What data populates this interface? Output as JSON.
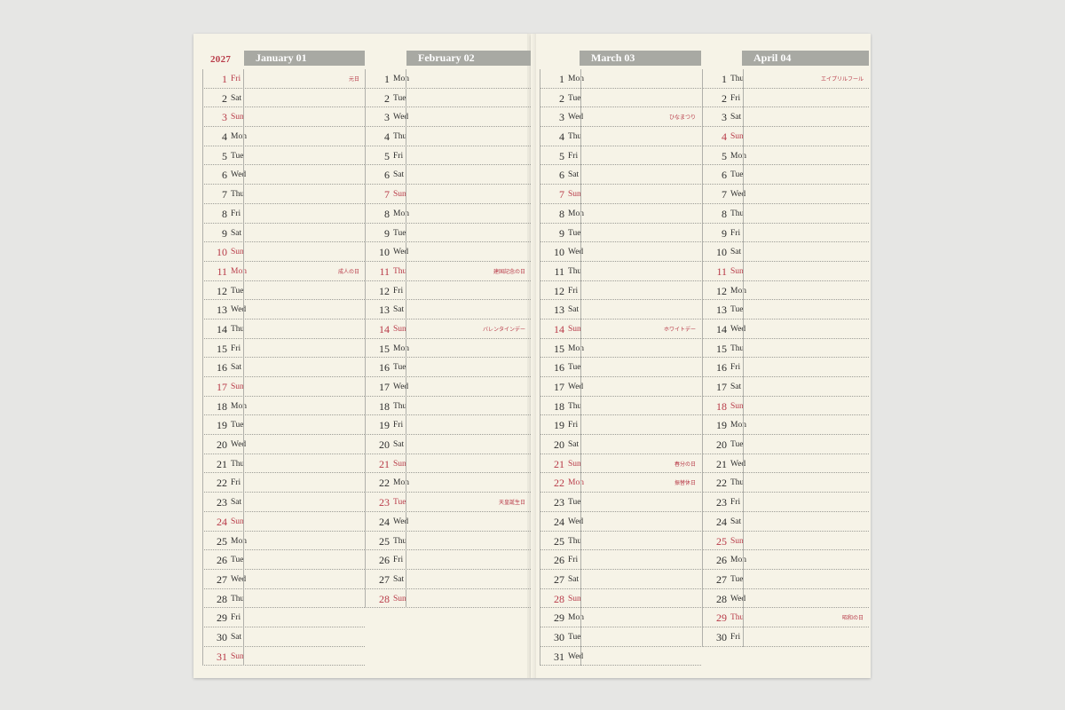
{
  "year": "2027",
  "colors": {
    "holiday": "#b83a48",
    "header_bg": "#a8a9a3",
    "paper": "#f6f3e7",
    "background": "#e6e6e4"
  },
  "months": [
    {
      "header": "January 01",
      "days": [
        {
          "d": "1",
          "w": "Fri",
          "red": true,
          "note": "元日"
        },
        {
          "d": "2",
          "w": "Sat"
        },
        {
          "d": "3",
          "w": "Sun",
          "red": true
        },
        {
          "d": "4",
          "w": "Mon"
        },
        {
          "d": "5",
          "w": "Tue"
        },
        {
          "d": "6",
          "w": "Wed"
        },
        {
          "d": "7",
          "w": "Thu"
        },
        {
          "d": "8",
          "w": "Fri"
        },
        {
          "d": "9",
          "w": "Sat"
        },
        {
          "d": "10",
          "w": "Sun",
          "red": true
        },
        {
          "d": "11",
          "w": "Mon",
          "red": true,
          "note": "成人の日"
        },
        {
          "d": "12",
          "w": "Tue"
        },
        {
          "d": "13",
          "w": "Wed"
        },
        {
          "d": "14",
          "w": "Thu"
        },
        {
          "d": "15",
          "w": "Fri"
        },
        {
          "d": "16",
          "w": "Sat"
        },
        {
          "d": "17",
          "w": "Sun",
          "red": true
        },
        {
          "d": "18",
          "w": "Mon"
        },
        {
          "d": "19",
          "w": "Tue"
        },
        {
          "d": "20",
          "w": "Wed"
        },
        {
          "d": "21",
          "w": "Thu"
        },
        {
          "d": "22",
          "w": "Fri"
        },
        {
          "d": "23",
          "w": "Sat"
        },
        {
          "d": "24",
          "w": "Sun",
          "red": true
        },
        {
          "d": "25",
          "w": "Mon"
        },
        {
          "d": "26",
          "w": "Tue"
        },
        {
          "d": "27",
          "w": "Wed"
        },
        {
          "d": "28",
          "w": "Thu"
        },
        {
          "d": "29",
          "w": "Fri"
        },
        {
          "d": "30",
          "w": "Sat"
        },
        {
          "d": "31",
          "w": "Sun",
          "red": true
        }
      ]
    },
    {
      "header": "February 02",
      "days": [
        {
          "d": "1",
          "w": "Mon"
        },
        {
          "d": "2",
          "w": "Tue"
        },
        {
          "d": "3",
          "w": "Wed"
        },
        {
          "d": "4",
          "w": "Thu"
        },
        {
          "d": "5",
          "w": "Fri"
        },
        {
          "d": "6",
          "w": "Sat"
        },
        {
          "d": "7",
          "w": "Sun",
          "red": true
        },
        {
          "d": "8",
          "w": "Mon"
        },
        {
          "d": "9",
          "w": "Tue"
        },
        {
          "d": "10",
          "w": "Wed"
        },
        {
          "d": "11",
          "w": "Thu",
          "red": true,
          "note": "建国記念の日"
        },
        {
          "d": "12",
          "w": "Fri"
        },
        {
          "d": "13",
          "w": "Sat"
        },
        {
          "d": "14",
          "w": "Sun",
          "red": true,
          "note": "バレンタインデー"
        },
        {
          "d": "15",
          "w": "Mon"
        },
        {
          "d": "16",
          "w": "Tue"
        },
        {
          "d": "17",
          "w": "Wed"
        },
        {
          "d": "18",
          "w": "Thu"
        },
        {
          "d": "19",
          "w": "Fri"
        },
        {
          "d": "20",
          "w": "Sat"
        },
        {
          "d": "21",
          "w": "Sun",
          "red": true
        },
        {
          "d": "22",
          "w": "Mon"
        },
        {
          "d": "23",
          "w": "Tue",
          "red": true,
          "note": "天皇誕生日"
        },
        {
          "d": "24",
          "w": "Wed"
        },
        {
          "d": "25",
          "w": "Thu"
        },
        {
          "d": "26",
          "w": "Fri"
        },
        {
          "d": "27",
          "w": "Sat"
        },
        {
          "d": "28",
          "w": "Sun",
          "red": true
        }
      ]
    },
    {
      "header": "March 03",
      "days": [
        {
          "d": "1",
          "w": "Mon"
        },
        {
          "d": "2",
          "w": "Tue"
        },
        {
          "d": "3",
          "w": "Wed",
          "note": "ひなまつり"
        },
        {
          "d": "4",
          "w": "Thu"
        },
        {
          "d": "5",
          "w": "Fri"
        },
        {
          "d": "6",
          "w": "Sat"
        },
        {
          "d": "7",
          "w": "Sun",
          "red": true
        },
        {
          "d": "8",
          "w": "Mon"
        },
        {
          "d": "9",
          "w": "Tue"
        },
        {
          "d": "10",
          "w": "Wed"
        },
        {
          "d": "11",
          "w": "Thu"
        },
        {
          "d": "12",
          "w": "Fri"
        },
        {
          "d": "13",
          "w": "Sat"
        },
        {
          "d": "14",
          "w": "Sun",
          "red": true,
          "note": "ホワイトデー"
        },
        {
          "d": "15",
          "w": "Mon"
        },
        {
          "d": "16",
          "w": "Tue"
        },
        {
          "d": "17",
          "w": "Wed"
        },
        {
          "d": "18",
          "w": "Thu"
        },
        {
          "d": "19",
          "w": "Fri"
        },
        {
          "d": "20",
          "w": "Sat"
        },
        {
          "d": "21",
          "w": "Sun",
          "red": true,
          "note": "春分の日"
        },
        {
          "d": "22",
          "w": "Mon",
          "red": true,
          "note": "振替休日"
        },
        {
          "d": "23",
          "w": "Tue"
        },
        {
          "d": "24",
          "w": "Wed"
        },
        {
          "d": "25",
          "w": "Thu"
        },
        {
          "d": "26",
          "w": "Fri"
        },
        {
          "d": "27",
          "w": "Sat"
        },
        {
          "d": "28",
          "w": "Sun",
          "red": true
        },
        {
          "d": "29",
          "w": "Mon"
        },
        {
          "d": "30",
          "w": "Tue"
        },
        {
          "d": "31",
          "w": "Wed"
        }
      ]
    },
    {
      "header": "April 04",
      "days": [
        {
          "d": "1",
          "w": "Thu",
          "note": "エイプリルフール"
        },
        {
          "d": "2",
          "w": "Fri"
        },
        {
          "d": "3",
          "w": "Sat"
        },
        {
          "d": "4",
          "w": "Sun",
          "red": true
        },
        {
          "d": "5",
          "w": "Mon"
        },
        {
          "d": "6",
          "w": "Tue"
        },
        {
          "d": "7",
          "w": "Wed"
        },
        {
          "d": "8",
          "w": "Thu"
        },
        {
          "d": "9",
          "w": "Fri"
        },
        {
          "d": "10",
          "w": "Sat"
        },
        {
          "d": "11",
          "w": "Sun",
          "red": true
        },
        {
          "d": "12",
          "w": "Mon"
        },
        {
          "d": "13",
          "w": "Tue"
        },
        {
          "d": "14",
          "w": "Wed"
        },
        {
          "d": "15",
          "w": "Thu"
        },
        {
          "d": "16",
          "w": "Fri"
        },
        {
          "d": "17",
          "w": "Sat"
        },
        {
          "d": "18",
          "w": "Sun",
          "red": true
        },
        {
          "d": "19",
          "w": "Mon"
        },
        {
          "d": "20",
          "w": "Tue"
        },
        {
          "d": "21",
          "w": "Wed"
        },
        {
          "d": "22",
          "w": "Thu"
        },
        {
          "d": "23",
          "w": "Fri"
        },
        {
          "d": "24",
          "w": "Sat"
        },
        {
          "d": "25",
          "w": "Sun",
          "red": true
        },
        {
          "d": "26",
          "w": "Mon"
        },
        {
          "d": "27",
          "w": "Tue"
        },
        {
          "d": "28",
          "w": "Wed"
        },
        {
          "d": "29",
          "w": "Thu",
          "red": true,
          "note": "昭和の日"
        },
        {
          "d": "30",
          "w": "Fri"
        }
      ]
    }
  ]
}
